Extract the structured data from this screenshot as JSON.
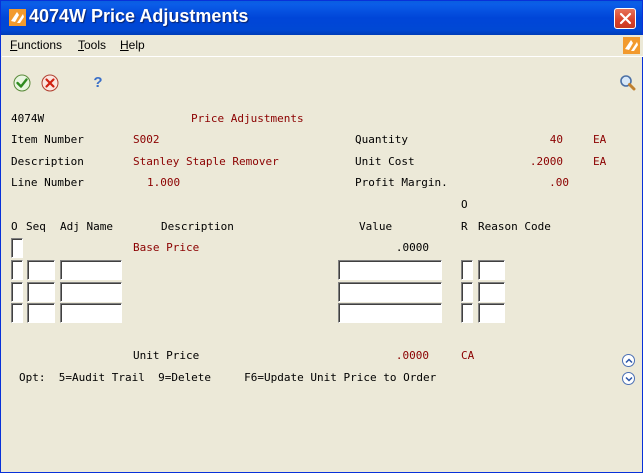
{
  "window": {
    "title": "4074W   Price Adjustments"
  },
  "menu": {
    "functions": "Functions",
    "functions_mnemonic": "F",
    "functions_rest": "unctions",
    "tools_mnemonic": "T",
    "tools_rest": "ools",
    "help_mnemonic": "H",
    "help_rest": "elp"
  },
  "toolbar": {
    "ok_icon": "checkmark-icon",
    "cancel_icon": "cancel-icon",
    "help_icon": "question-mark-icon",
    "search_icon": "magnifier-icon",
    "help_label": "?"
  },
  "form": {
    "program_id": "4074W",
    "form_title": "Price Adjustments",
    "item_number_label": "Item Number",
    "item_number_value": "S002",
    "description_label": "Description",
    "description_value": "Stanley Staple Remover",
    "line_number_label": "Line Number",
    "line_number_value": "1.000",
    "quantity_label": "Quantity",
    "quantity_value": "40",
    "quantity_uom": "EA",
    "unit_cost_label": "Unit Cost",
    "unit_cost_value": ".2000",
    "unit_cost_uom": "EA",
    "profit_margin_label": "Profit Margin.",
    "profit_margin_value": ".00"
  },
  "grid": {
    "headers": {
      "o": "O",
      "seq": "Seq",
      "adj_name": "Adj Name",
      "description": "Description",
      "value": "Value",
      "or_top": "O",
      "or_bottom": "R",
      "reason_code": "Reason Code"
    },
    "base_row": {
      "description": "Base Price",
      "value": ".0000"
    }
  },
  "footer": {
    "unit_price_label": "Unit Price",
    "unit_price_value": ".0000",
    "unit_price_currency": "CA",
    "options_line": "Opt:  5=Audit Trail  9=Delete     F6=Update Unit Price to Order"
  },
  "colors": {
    "value_text": "#8B0000",
    "titlebar": "#0045D8",
    "window_bg": "#ECE9D8"
  }
}
